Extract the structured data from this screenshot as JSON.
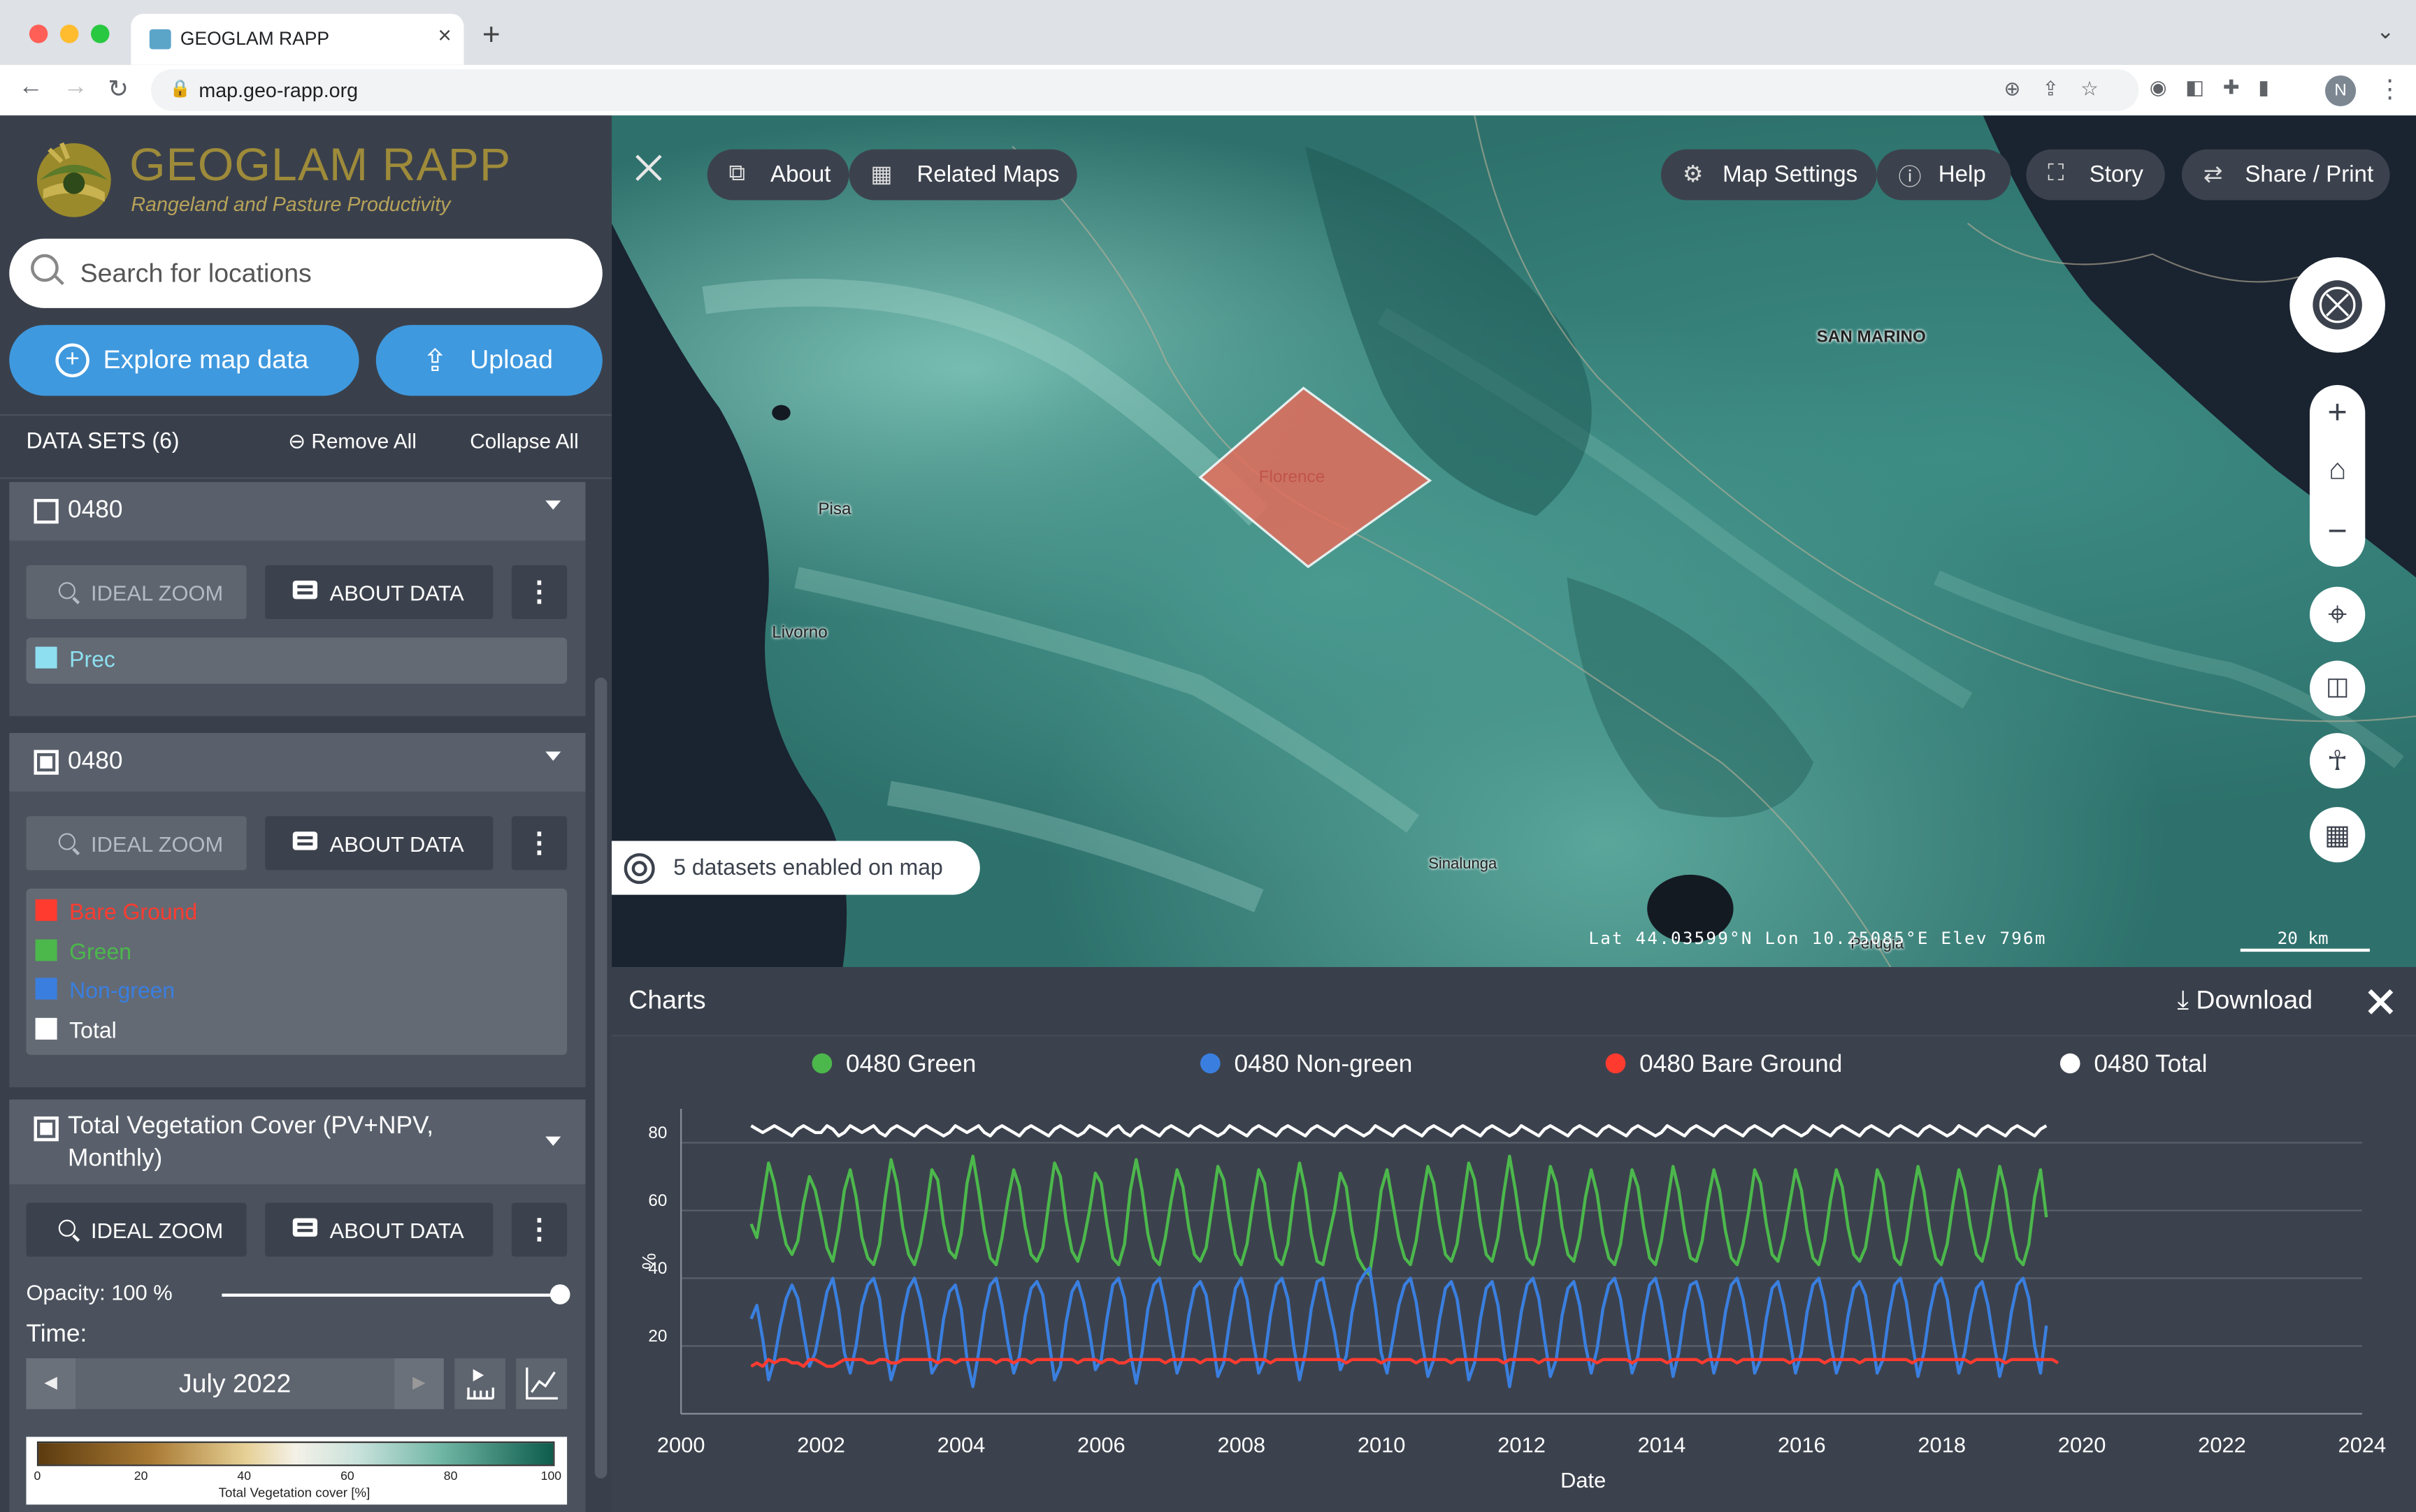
{
  "browser": {
    "tab_title": "GEOGLAM RAPP",
    "url": "map.geo-rapp.org",
    "avatar": "N"
  },
  "app": {
    "logo_title": "GEOGLAM RAPP",
    "logo_subtitle": "Rangeland and Pasture Productivity",
    "search_placeholder": "Search for locations",
    "explore_label": "Explore map data",
    "upload_label": "Upload",
    "datasets_header": "DATA SETS (6)",
    "remove_all": "Remove All",
    "collapse_all": "Collapse All"
  },
  "workbench": [
    {
      "name": "0480",
      "ideal_zoom": "IDEAL ZOOM",
      "about_data": "ABOUT DATA",
      "legend": [
        {
          "label": "Prec",
          "color": "#8ee0f0"
        }
      ]
    },
    {
      "name": "0480",
      "ideal_zoom": "IDEAL ZOOM",
      "about_data": "ABOUT DATA",
      "legend": [
        {
          "label": "Bare Ground",
          "color": "#ff3b30"
        },
        {
          "label": "Green",
          "color": "#4cb84c"
        },
        {
          "label": "Non-green",
          "color": "#3a7fe0"
        },
        {
          "label": "Total",
          "color": "#ffffff"
        }
      ]
    },
    {
      "name_line1": "Total Vegetation Cover (PV+NPV,",
      "name_line2": "Monthly)",
      "ideal_zoom": "IDEAL ZOOM",
      "about_data": "ABOUT DATA",
      "opacity_label": "Opacity: 100 %",
      "opacity": 1.0,
      "time_label": "Time:",
      "time_value": "July 2022",
      "colorbar": {
        "ticks": [
          "0",
          "20",
          "40",
          "60",
          "80",
          "100"
        ],
        "label": "Total Vegetation cover [%]"
      }
    }
  ],
  "map": {
    "controls": {
      "about": "About",
      "related_maps": "Related Maps",
      "map_settings": "Map Settings",
      "help": "Help",
      "story": "Story",
      "share_print": "Share / Print"
    },
    "datasets_enabled": "5 datasets enabled on map",
    "coords": "Lat  44.03599°N  Lon  10.25085°E  Elev  796m",
    "scale": "20 km",
    "places": [
      "SAN MARINO",
      "Pisa",
      "Livorno",
      "Florence",
      "Sinalunga",
      "Perugia"
    ],
    "icons": [
      "compass-icon",
      "zoom-in-icon",
      "home-icon",
      "zoom-out-icon",
      "locate-icon",
      "split-icon",
      "accessibility-icon",
      "apps-grid-icon"
    ],
    "colors": {
      "water": "#1a2330",
      "polygon": "#e46d5c"
    }
  },
  "charts": {
    "title": "Charts",
    "download": "Download",
    "legend": [
      {
        "label": "0480 Green",
        "color": "#4cb84c"
      },
      {
        "label": "0480 Non-green",
        "color": "#3a7fe0"
      },
      {
        "label": "0480 Bare Ground",
        "color": "#ff3b30"
      },
      {
        "label": "0480 Total",
        "color": "#ffffff"
      }
    ]
  },
  "chart_data": {
    "type": "line",
    "xlabel": "Date",
    "ylabel": "%",
    "xlim": [
      2000,
      2024
    ],
    "ylim": [
      0,
      90
    ],
    "xticks": [
      2000,
      2002,
      2004,
      2006,
      2008,
      2010,
      2012,
      2014,
      2016,
      2018,
      2020,
      2022,
      2024
    ],
    "yticks": [
      20,
      40,
      60,
      80
    ],
    "grid": "horizontal",
    "x_start": 2001.0,
    "x_step": 0.0833,
    "pattern_note_free": true,
    "series": [
      {
        "name": "0480 Green",
        "color": "#4cb84c",
        "values": [
          56,
          52,
          63,
          74,
          68,
          58,
          50,
          47,
          51,
          62,
          70,
          66,
          58,
          49,
          45,
          54,
          66,
          72,
          64,
          52,
          46,
          44,
          50,
          64,
          75,
          68,
          55,
          47,
          44,
          50,
          60,
          72,
          69,
          56,
          48,
          46,
          53,
          68,
          76,
          66,
          54,
          46,
          44,
          52,
          63,
          72,
          67,
          55,
          47,
          45,
          49,
          62,
          74,
          70,
          57,
          48,
          45,
          51,
          60,
          71,
          68,
          56,
          46,
          44,
          50,
          66,
          75,
          66,
          53,
          46,
          44,
          52,
          63,
          72,
          67,
          55,
          47,
          45,
          49,
          61,
          73,
          69,
          57,
          47,
          44,
          50,
          62,
          72,
          68,
          55,
          46,
          44,
          50,
          64,
          74,
          66,
          53,
          45,
          44,
          52,
          60,
          71,
          67,
          54,
          46,
          43,
          41,
          52,
          66,
          72,
          62,
          52,
          46,
          44,
          51,
          63,
          73,
          68,
          56,
          47,
          45,
          50,
          62,
          74,
          69,
          56,
          47,
          45,
          52,
          65,
          76,
          66,
          54,
          46,
          44,
          50,
          62,
          73,
          68,
          55,
          47,
          45,
          52,
          64,
          72,
          65,
          53,
          46,
          44,
          50,
          62,
          72,
          67,
          55,
          46,
          44,
          51,
          62,
          73,
          66,
          54,
          46,
          45,
          51,
          63,
          72,
          66,
          54,
          46,
          44,
          50,
          60,
          72,
          68,
          56,
          47,
          45,
          52,
          62,
          72,
          66,
          54,
          46,
          44,
          51,
          63,
          72,
          67,
          55,
          47,
          45,
          49,
          60,
          72,
          68,
          55,
          46,
          44,
          51,
          63,
          73,
          66,
          54,
          46,
          44,
          50,
          62,
          72,
          66,
          55,
          47,
          45,
          52,
          63,
          73,
          66,
          54,
          46,
          44,
          50,
          64,
          72,
          58
        ]
      },
      {
        "name": "0480 Non-green",
        "color": "#3a7fe0",
        "values": [
          28,
          32,
          22,
          10,
          16,
          26,
          34,
          38,
          34,
          24,
          14,
          18,
          27,
          36,
          40,
          31,
          18,
          12,
          20,
          32,
          38,
          40,
          34,
          20,
          10,
          16,
          29,
          37,
          40,
          34,
          24,
          12,
          15,
          28,
          36,
          38,
          31,
          16,
          8,
          18,
          30,
          38,
          40,
          32,
          21,
          12,
          17,
          29,
          37,
          39,
          35,
          22,
          10,
          14,
          27,
          36,
          39,
          33,
          24,
          13,
          16,
          28,
          38,
          40,
          34,
          18,
          9,
          18,
          31,
          38,
          40,
          32,
          21,
          12,
          17,
          29,
          37,
          39,
          35,
          23,
          11,
          15,
          27,
          37,
          40,
          34,
          22,
          12,
          16,
          29,
          38,
          40,
          34,
          20,
          10,
          18,
          31,
          39,
          40,
          32,
          24,
          13,
          17,
          30,
          38,
          41,
          43,
          32,
          18,
          12,
          22,
          32,
          38,
          40,
          33,
          21,
          11,
          16,
          28,
          37,
          39,
          34,
          22,
          10,
          15,
          28,
          37,
          39,
          32,
          19,
          8,
          18,
          30,
          38,
          40,
          34,
          22,
          11,
          16,
          29,
          37,
          39,
          32,
          20,
          12,
          19,
          31,
          38,
          40,
          34,
          22,
          12,
          17,
          29,
          38,
          40,
          33,
          22,
          11,
          18,
          30,
          38,
          39,
          33,
          21,
          12,
          18,
          30,
          38,
          40,
          34,
          24,
          12,
          16,
          28,
          37,
          39,
          32,
          22,
          12,
          18,
          30,
          38,
          40,
          33,
          21,
          12,
          17,
          29,
          37,
          39,
          35,
          24,
          12,
          16,
          29,
          38,
          40,
          33,
          21,
          11,
          18,
          30,
          38,
          40,
          34,
          22,
          12,
          18,
          29,
          37,
          39,
          32,
          21,
          11,
          18,
          30,
          38,
          40,
          34,
          20,
          12,
          26
        ]
      },
      {
        "name": "0480 Bare Ground",
        "color": "#ff3b30",
        "values": [
          14,
          15,
          14,
          16,
          15,
          16,
          16,
          15,
          15,
          14,
          16,
          16,
          15,
          14,
          14,
          15,
          16,
          16,
          16,
          16,
          15,
          15,
          16,
          16,
          15,
          15,
          16,
          16,
          16,
          16,
          16,
          16,
          15,
          16,
          16,
          15,
          16,
          16,
          16,
          16,
          16,
          16,
          15,
          16,
          16,
          15,
          16,
          16,
          15,
          16,
          16,
          16,
          16,
          16,
          16,
          16,
          15,
          16,
          16,
          16,
          15,
          16,
          16,
          15,
          15,
          16,
          16,
          16,
          16,
          16,
          16,
          15,
          16,
          16,
          16,
          16,
          16,
          15,
          16,
          16,
          16,
          16,
          16,
          15,
          16,
          16,
          16,
          16,
          16,
          15,
          16,
          16,
          16,
          16,
          16,
          16,
          16,
          16,
          16,
          16,
          16,
          16,
          15,
          16,
          16,
          16,
          16,
          16,
          15,
          16,
          16,
          16,
          16,
          16,
          15,
          16,
          16,
          16,
          16,
          16,
          15,
          16,
          16,
          16,
          16,
          16,
          16,
          16,
          16,
          15,
          16,
          16,
          16,
          16,
          16,
          15,
          16,
          16,
          16,
          16,
          16,
          16,
          16,
          16,
          16,
          15,
          16,
          16,
          16,
          16,
          16,
          15,
          16,
          16,
          16,
          16,
          16,
          15,
          16,
          16,
          16,
          16,
          16,
          15,
          16,
          16,
          16,
          16,
          16,
          15,
          16,
          16,
          16,
          16,
          16,
          16,
          16,
          16,
          15,
          16,
          16,
          16,
          16,
          16,
          15,
          16,
          16,
          16,
          16,
          16,
          15,
          16,
          16,
          16,
          16,
          16,
          16,
          16,
          16,
          15,
          16,
          16,
          16,
          16,
          16,
          16,
          16,
          16,
          16,
          15,
          16,
          16,
          16,
          16,
          16,
          15,
          16,
          16,
          16,
          16,
          16,
          16,
          16,
          16,
          15
        ]
      },
      {
        "name": "0480 Total",
        "color": "#ffffff",
        "values": [
          85,
          84,
          83,
          84,
          85,
          84,
          83,
          82,
          84,
          85,
          84,
          83,
          83,
          85,
          84,
          82,
          83,
          85,
          84,
          83,
          84,
          85,
          83,
          82,
          84,
          85,
          84,
          83,
          82,
          84,
          85,
          84,
          83,
          82,
          83,
          85,
          84,
          83,
          84,
          85,
          83,
          82,
          84,
          85,
          84,
          83,
          82,
          84,
          85,
          84,
          83,
          82,
          84,
          85,
          84,
          83,
          82,
          83,
          85,
          84,
          83,
          82,
          84,
          85,
          83,
          82,
          84,
          85,
          84,
          83,
          82,
          84,
          85,
          84,
          83,
          82,
          84,
          85,
          84,
          83,
          82,
          83,
          85,
          84,
          83,
          82,
          84,
          85,
          84,
          83,
          82,
          84,
          85,
          84,
          83,
          82,
          84,
          85,
          84,
          83,
          82,
          84,
          85,
          84,
          83,
          82,
          83,
          85,
          84,
          83,
          82,
          84,
          85,
          84,
          83,
          82,
          84,
          85,
          84,
          83,
          82,
          84,
          85,
          84,
          83,
          82,
          84,
          85,
          84,
          83,
          82,
          83,
          85,
          84,
          83,
          82,
          84,
          85,
          84,
          83,
          82,
          84,
          85,
          84,
          83,
          82,
          84,
          85,
          84,
          83,
          82,
          84,
          85,
          84,
          83,
          82,
          83,
          85,
          84,
          83,
          82,
          84,
          85,
          84,
          83,
          82,
          84,
          85,
          84,
          83,
          82,
          84,
          85,
          84,
          83,
          82,
          84,
          85,
          84,
          83,
          82,
          83,
          85,
          84,
          83,
          82,
          84,
          85,
          84,
          83,
          82,
          84,
          85,
          84,
          83,
          82,
          84,
          85,
          84,
          83,
          82,
          84,
          85,
          84,
          83,
          82,
          83,
          85,
          84,
          83,
          82,
          84,
          85,
          84,
          83,
          82,
          84,
          85,
          84,
          83,
          82,
          84,
          85
        ]
      }
    ]
  }
}
